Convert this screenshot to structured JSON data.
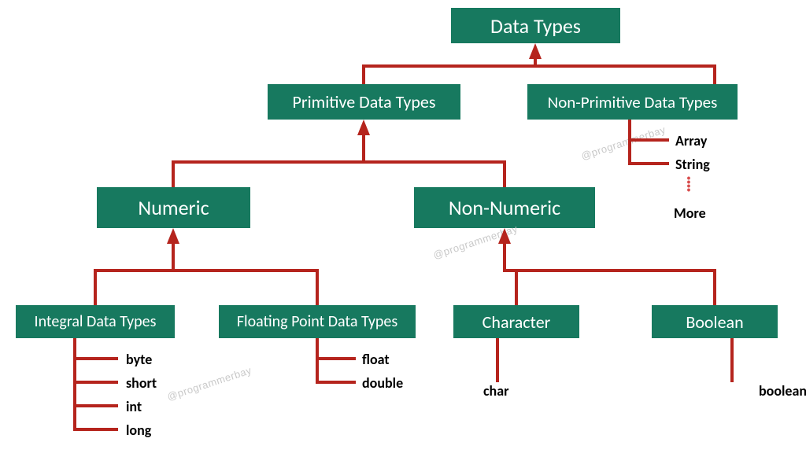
{
  "colors": {
    "box": "#17795f",
    "line": "#b5241d",
    "text": "#000000"
  },
  "watermark": "@programmerbay",
  "nodes": {
    "root": "Data Types",
    "primitive": "Primitive Data Types",
    "nonprimitive": "Non-Primitive Data Types",
    "numeric": "Numeric",
    "nonnumeric": "Non-Numeric",
    "integral": "Integral Data Types",
    "floating": "Floating Point Data Types",
    "character": "Character",
    "boolean": "Boolean"
  },
  "leaves": {
    "nonprimitive": [
      "Array",
      "String"
    ],
    "nonprimitive_more": "More",
    "integral": [
      "byte",
      "short",
      "int",
      "long"
    ],
    "floating": [
      "float",
      "double"
    ],
    "character": [
      "char"
    ],
    "boolean": [
      "boolean"
    ]
  }
}
